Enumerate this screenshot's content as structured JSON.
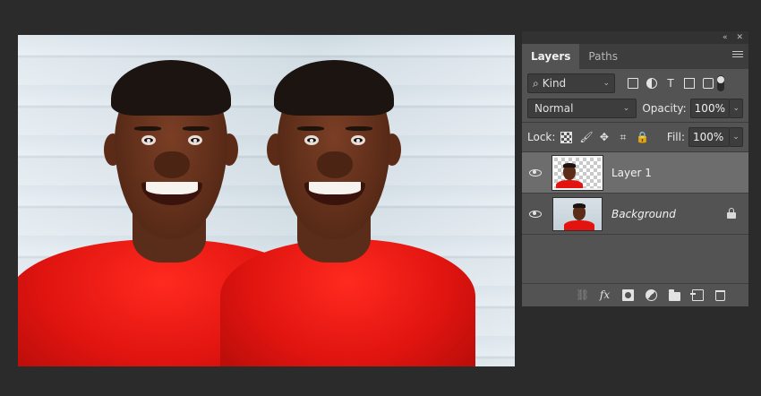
{
  "panel": {
    "top_icons": {
      "collapse": "«",
      "close": "✕"
    },
    "tabs": [
      {
        "label": "Layers",
        "active": true
      },
      {
        "label": "Paths",
        "active": false
      }
    ],
    "filter": {
      "kind_label": "Kind",
      "search_glyph": "⌕"
    },
    "blend_mode": "Normal",
    "opacity_label": "Opacity:",
    "opacity_value": "100%",
    "lock_label": "Lock:",
    "fill_label": "Fill:",
    "fill_value": "100%",
    "layers": [
      {
        "name": "Layer 1",
        "selected": true,
        "visible": true,
        "transparent": true
      },
      {
        "name": "Background",
        "selected": false,
        "visible": true,
        "locked": true
      }
    ]
  },
  "colors": {
    "app_bg": "#2b2b2b",
    "panel_bg": "#535353",
    "selected_layer": "#6d6d6d",
    "sweater_red": "#e01410"
  }
}
